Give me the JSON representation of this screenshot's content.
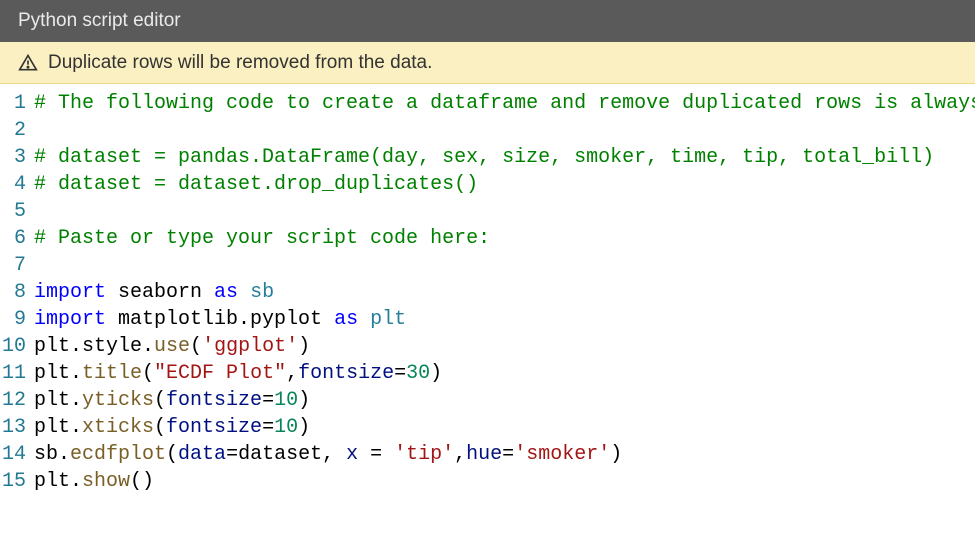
{
  "titlebar": {
    "text": "Python script editor"
  },
  "warning": {
    "text": "Duplicate rows will be removed from the data."
  },
  "editor": {
    "line_count": 15,
    "lines": [
      [
        {
          "t": "# The following code to create a dataframe and remove duplicated rows is always",
          "c": "comment"
        }
      ],
      [],
      [
        {
          "t": "# dataset = pandas.DataFrame(day, sex, size, smoker, time, tip, total_bill)",
          "c": "comment"
        }
      ],
      [
        {
          "t": "# dataset = dataset.drop_duplicates()",
          "c": "comment"
        }
      ],
      [],
      [
        {
          "t": "# Paste or type your script code here:",
          "c": "comment"
        }
      ],
      [],
      [
        {
          "t": "import",
          "c": "keyword"
        },
        {
          "t": " seaborn ",
          "c": "default"
        },
        {
          "t": "as",
          "c": "keyword"
        },
        {
          "t": " sb",
          "c": "module"
        }
      ],
      [
        {
          "t": "import",
          "c": "keyword"
        },
        {
          "t": " matplotlib.pyplot ",
          "c": "default"
        },
        {
          "t": "as",
          "c": "keyword"
        },
        {
          "t": " plt",
          "c": "module"
        }
      ],
      [
        {
          "t": "plt.style.",
          "c": "default"
        },
        {
          "t": "use",
          "c": "func"
        },
        {
          "t": "(",
          "c": "default"
        },
        {
          "t": "'ggplot'",
          "c": "string"
        },
        {
          "t": ")",
          "c": "default"
        }
      ],
      [
        {
          "t": "plt.",
          "c": "default"
        },
        {
          "t": "title",
          "c": "func"
        },
        {
          "t": "(",
          "c": "default"
        },
        {
          "t": "\"ECDF Plot\"",
          "c": "string"
        },
        {
          "t": ",",
          "c": "default"
        },
        {
          "t": "fontsize",
          "c": "param"
        },
        {
          "t": "=",
          "c": "default"
        },
        {
          "t": "30",
          "c": "number"
        },
        {
          "t": ")",
          "c": "default"
        }
      ],
      [
        {
          "t": "plt.",
          "c": "default"
        },
        {
          "t": "yticks",
          "c": "func"
        },
        {
          "t": "(",
          "c": "default"
        },
        {
          "t": "fontsize",
          "c": "param"
        },
        {
          "t": "=",
          "c": "default"
        },
        {
          "t": "10",
          "c": "number"
        },
        {
          "t": ")",
          "c": "default"
        }
      ],
      [
        {
          "t": "plt.",
          "c": "default"
        },
        {
          "t": "xticks",
          "c": "func"
        },
        {
          "t": "(",
          "c": "default"
        },
        {
          "t": "fontsize",
          "c": "param"
        },
        {
          "t": "=",
          "c": "default"
        },
        {
          "t": "10",
          "c": "number"
        },
        {
          "t": ")",
          "c": "default"
        }
      ],
      [
        {
          "t": "sb.",
          "c": "default"
        },
        {
          "t": "ecdfplot",
          "c": "func"
        },
        {
          "t": "(",
          "c": "default"
        },
        {
          "t": "data",
          "c": "param"
        },
        {
          "t": "=dataset, ",
          "c": "default"
        },
        {
          "t": "x",
          "c": "param"
        },
        {
          "t": " = ",
          "c": "default"
        },
        {
          "t": "'tip'",
          "c": "string"
        },
        {
          "t": ",",
          "c": "default"
        },
        {
          "t": "hue",
          "c": "param"
        },
        {
          "t": "=",
          "c": "default"
        },
        {
          "t": "'smoker'",
          "c": "string"
        },
        {
          "t": ")",
          "c": "default"
        }
      ],
      [
        {
          "t": "plt.",
          "c": "default"
        },
        {
          "t": "show",
          "c": "func"
        },
        {
          "t": "()",
          "c": "default"
        }
      ]
    ]
  }
}
